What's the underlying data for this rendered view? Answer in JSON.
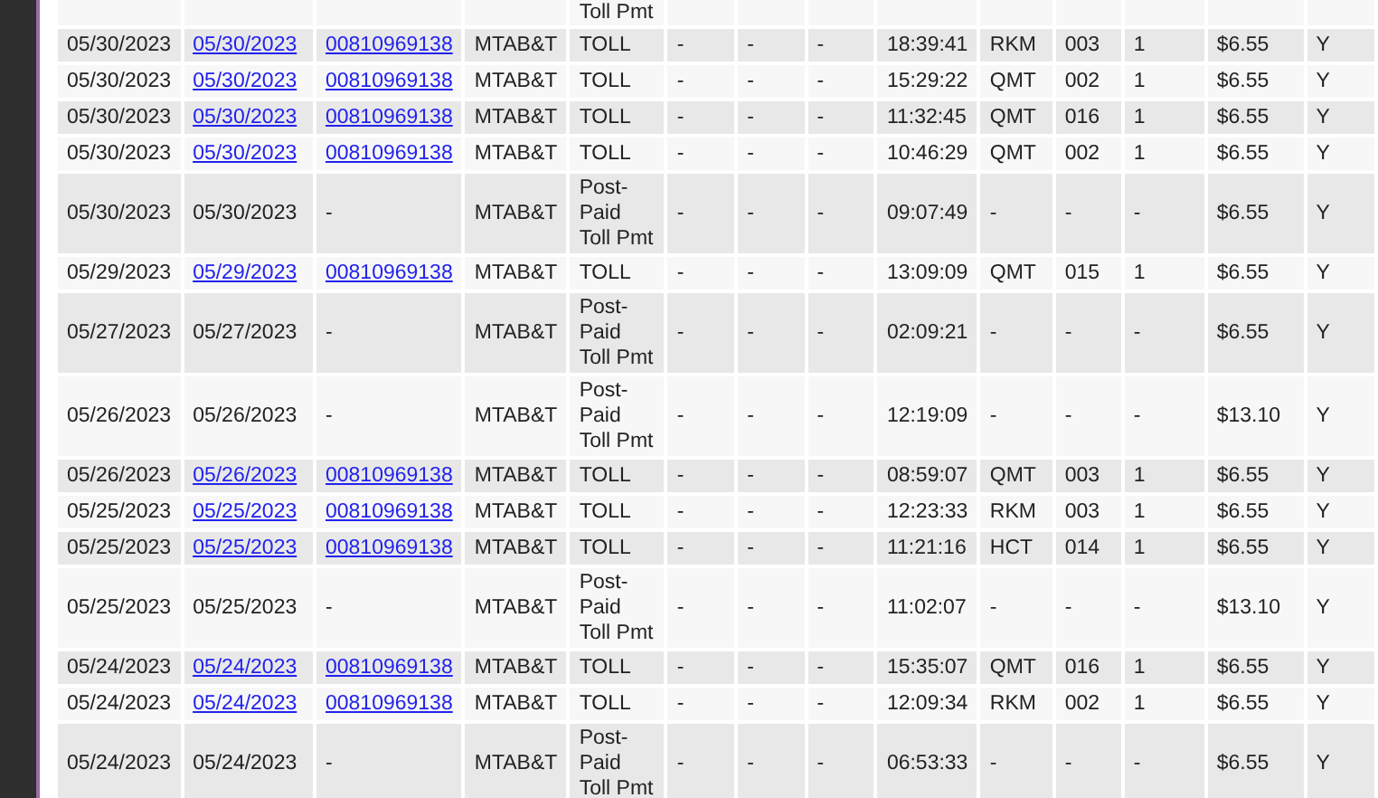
{
  "table": {
    "cut_row": {
      "column_5": "Toll Pmt"
    },
    "rows": [
      {
        "kind": "toll",
        "cells": [
          "05/30/2023",
          "05/30/2023",
          "00810969138",
          "MTAB&T",
          "TOLL",
          "-",
          "-",
          "-",
          "18:39:41",
          "RKM",
          "003",
          "1",
          "$6.55",
          "Y"
        ]
      },
      {
        "kind": "toll",
        "cells": [
          "05/30/2023",
          "05/30/2023",
          "00810969138",
          "MTAB&T",
          "TOLL",
          "-",
          "-",
          "-",
          "15:29:22",
          "QMT",
          "002",
          "1",
          "$6.55",
          "Y"
        ]
      },
      {
        "kind": "toll",
        "cells": [
          "05/30/2023",
          "05/30/2023",
          "00810969138",
          "MTAB&T",
          "TOLL",
          "-",
          "-",
          "-",
          "11:32:45",
          "QMT",
          "016",
          "1",
          "$6.55",
          "Y"
        ]
      },
      {
        "kind": "toll",
        "cells": [
          "05/30/2023",
          "05/30/2023",
          "00810969138",
          "MTAB&T",
          "TOLL",
          "-",
          "-",
          "-",
          "10:46:29",
          "QMT",
          "002",
          "1",
          "$6.55",
          "Y"
        ]
      },
      {
        "kind": "payment",
        "cells": [
          "05/30/2023",
          "05/30/2023",
          "-",
          "MTAB&T",
          "Post-Paid Toll Pmt",
          "-",
          "-",
          "-",
          "09:07:49",
          "-",
          "-",
          "-",
          "$6.55",
          "Y"
        ]
      },
      {
        "kind": "toll",
        "cells": [
          "05/29/2023",
          "05/29/2023",
          "00810969138",
          "MTAB&T",
          "TOLL",
          "-",
          "-",
          "-",
          "13:09:09",
          "QMT",
          "015",
          "1",
          "$6.55",
          "Y"
        ]
      },
      {
        "kind": "payment",
        "cells": [
          "05/27/2023",
          "05/27/2023",
          "-",
          "MTAB&T",
          "Post-Paid Toll Pmt",
          "-",
          "-",
          "-",
          "02:09:21",
          "-",
          "-",
          "-",
          "$6.55",
          "Y"
        ]
      },
      {
        "kind": "payment",
        "cells": [
          "05/26/2023",
          "05/26/2023",
          "-",
          "MTAB&T",
          "Post-Paid Toll Pmt",
          "-",
          "-",
          "-",
          "12:19:09",
          "-",
          "-",
          "-",
          "$13.10",
          "Y"
        ]
      },
      {
        "kind": "toll",
        "cells": [
          "05/26/2023",
          "05/26/2023",
          "00810969138",
          "MTAB&T",
          "TOLL",
          "-",
          "-",
          "-",
          "08:59:07",
          "QMT",
          "003",
          "1",
          "$6.55",
          "Y"
        ]
      },
      {
        "kind": "toll",
        "cells": [
          "05/25/2023",
          "05/25/2023",
          "00810969138",
          "MTAB&T",
          "TOLL",
          "-",
          "-",
          "-",
          "12:23:33",
          "RKM",
          "003",
          "1",
          "$6.55",
          "Y"
        ]
      },
      {
        "kind": "toll",
        "cells": [
          "05/25/2023",
          "05/25/2023",
          "00810969138",
          "MTAB&T",
          "TOLL",
          "-",
          "-",
          "-",
          "11:21:16",
          "HCT",
          "014",
          "1",
          "$6.55",
          "Y"
        ]
      },
      {
        "kind": "payment",
        "cells": [
          "05/25/2023",
          "05/25/2023",
          "-",
          "MTAB&T",
          "Post-Paid Toll Pmt",
          "-",
          "-",
          "-",
          "11:02:07",
          "-",
          "-",
          "-",
          "$13.10",
          "Y"
        ]
      },
      {
        "kind": "toll",
        "cells": [
          "05/24/2023",
          "05/24/2023",
          "00810969138",
          "MTAB&T",
          "TOLL",
          "-",
          "-",
          "-",
          "15:35:07",
          "QMT",
          "016",
          "1",
          "$6.55",
          "Y"
        ]
      },
      {
        "kind": "toll",
        "cells": [
          "05/24/2023",
          "05/24/2023",
          "00810969138",
          "MTAB&T",
          "TOLL",
          "-",
          "-",
          "-",
          "12:09:34",
          "RKM",
          "002",
          "1",
          "$6.55",
          "Y"
        ]
      },
      {
        "kind": "payment",
        "cells": [
          "05/24/2023",
          "05/24/2023",
          "-",
          "MTAB&T",
          "Post-Paid Toll Pmt",
          "-",
          "-",
          "-",
          "06:53:33",
          "-",
          "-",
          "-",
          "$6.55",
          "Y"
        ]
      }
    ]
  }
}
